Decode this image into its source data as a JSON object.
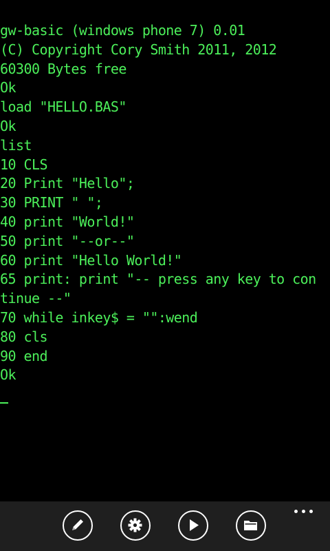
{
  "terminal": {
    "lines": [
      "gw-basic (windows phone 7) 0.01",
      "(C) Copyright Cory Smith 2011, 2012",
      "60300 Bytes free",
      "Ok",
      "load \"HELLO.BAS\"",
      "Ok",
      "list",
      "10 CLS",
      "20 Print \"Hello\";",
      "30 PRINT \" \";",
      "40 print \"World!\"",
      "50 print \"--or--\"",
      "60 print \"Hello World!\"",
      "65 print: print \"-- press any key to con",
      "tinue --\"",
      "70 while inkey$ = \"\":wend",
      "80 cls",
      "90 end",
      "Ok"
    ],
    "text_color": "#4cf05a",
    "background_color": "#000000"
  },
  "appbar": {
    "background_color": "#1f1f1f",
    "buttons": [
      {
        "icon": "edit-icon"
      },
      {
        "icon": "settings-icon"
      },
      {
        "icon": "play-icon"
      },
      {
        "icon": "folder-icon"
      }
    ],
    "more_icon": "ellipsis-icon"
  }
}
